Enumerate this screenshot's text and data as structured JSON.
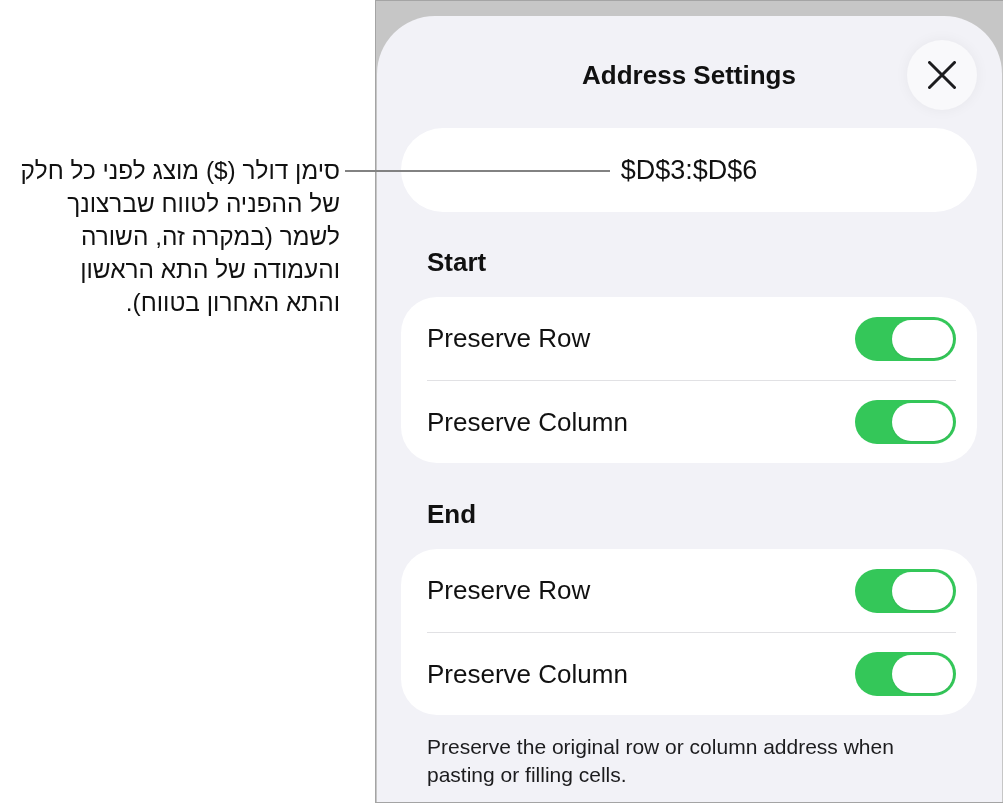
{
  "callout": {
    "text": "סימן דולר ($) מוצג לפני כל חלק\nשל ההפניה לטווח שברצונך\nלשמר (במקרה זה, השורה\nוהעמודה של התא הראשון\nוהתא האחרון בטווח)."
  },
  "sheet": {
    "title": "Address Settings",
    "address": "$D$3:$D$6",
    "sections": [
      {
        "heading": "Start",
        "rows": [
          {
            "label": "Preserve Row",
            "on": true
          },
          {
            "label": "Preserve Column",
            "on": true
          }
        ]
      },
      {
        "heading": "End",
        "rows": [
          {
            "label": "Preserve Row",
            "on": true
          },
          {
            "label": "Preserve Column",
            "on": true
          }
        ]
      }
    ],
    "footer": "Preserve the original row or column address when pasting or filling cells."
  }
}
